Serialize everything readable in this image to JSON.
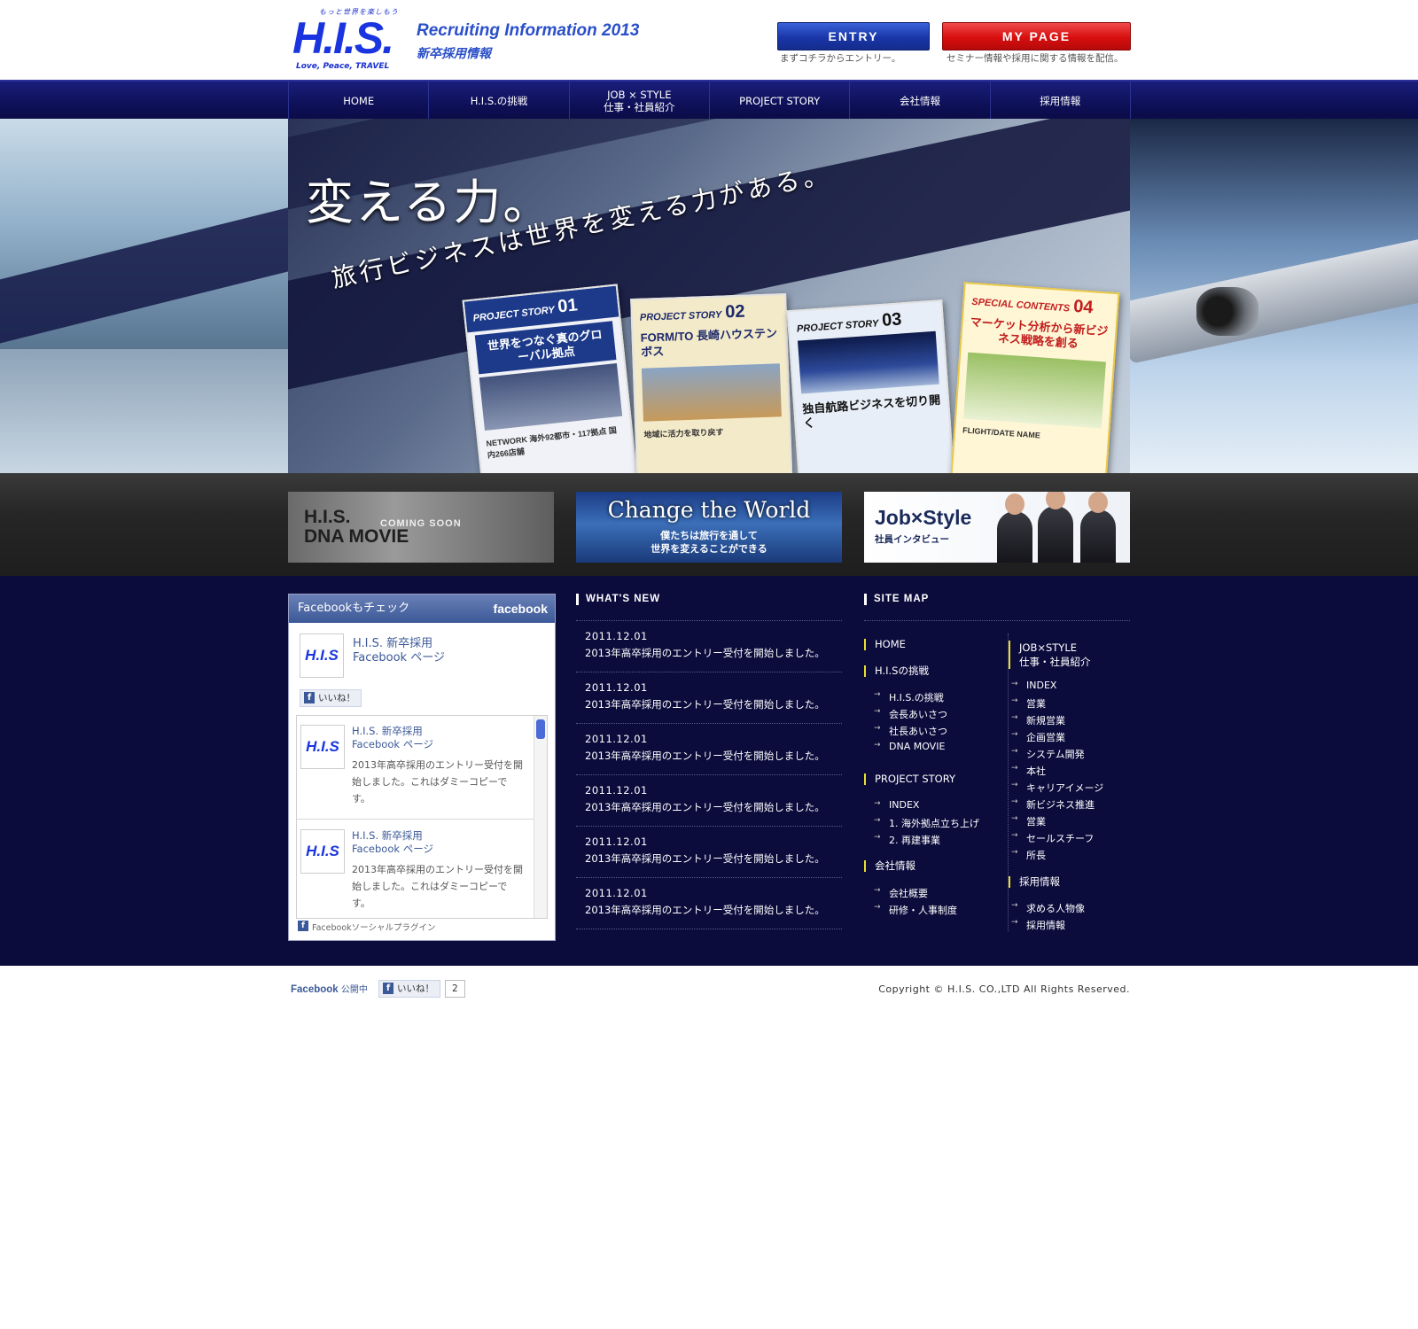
{
  "header": {
    "logo_tagline": "もっと世界を楽しもう",
    "logo_mark": "H.I.S.",
    "logo_slogan": "Love, Peace, TRAVEL",
    "title": "Recruiting Information 2013",
    "subtitle": "新卒採用情報",
    "entry_button": "ENTRY",
    "entry_note": "まずコチラからエントリー。",
    "mypage_button": "MY PAGE",
    "mypage_note": "セミナー情報や採用に関する情報を配信。",
    "colors": {
      "brand": "#1a35e0",
      "entry": "#1a36a8",
      "mypage": "#d80e0e"
    }
  },
  "nav": [
    {
      "label": "HOME"
    },
    {
      "label": "H.I.S.の挑戦"
    },
    {
      "label": "JOB × STYLE\n仕事・社員紹介"
    },
    {
      "label": "PROJECT STORY"
    },
    {
      "label": "会社情報"
    },
    {
      "label": "採用情報"
    }
  ],
  "hero": {
    "headline": "変える力。",
    "subline": "旅行ビジネスは世界を変える力がある。",
    "cards": [
      {
        "kicker": "PROJECT STORY",
        "num": "01",
        "headline": "世界をつなぐ真のグローバル拠点",
        "foot": "NETWORK 海外92都市・117拠点 国内266店舗"
      },
      {
        "kicker": "PROJECT STORY",
        "num": "02",
        "headline": "FORM/TO 長崎ハウステンボス",
        "foot": "地域に活力を取り戻す"
      },
      {
        "kicker": "PROJECT STORY",
        "num": "03",
        "headline": "独自航路ビジネスを切り開く",
        "foot": ""
      },
      {
        "kicker": "SPECIAL CONTENTS",
        "num": "04",
        "headline": "マーケット分析から新ビジネス戦略を創る",
        "foot": "FLIGHT/DATE  NAME"
      }
    ]
  },
  "banners": {
    "dna": {
      "title": "H.I.S.\nDNA MOVIE",
      "badge": "COMING SOON"
    },
    "world": {
      "title": "Change the World",
      "text": "僕たちは旅行を通して\n世界を変えることができる"
    },
    "job": {
      "title": "Job×Style",
      "text": "社員インタビュー"
    }
  },
  "facebook": {
    "header": "Facebookもチェック",
    "brand": "facebook",
    "avatar_text": "H.I.S",
    "page_name": "H.I.S. 新卒採用\nFacebook ページ",
    "like": "いいね！",
    "posts": [
      {
        "name": "H.I.S. 新卒採用\nFacebook ページ",
        "message": "2013年高卒採用のエントリー受付を開始しました。これはダミーコピーです。"
      },
      {
        "name": "H.I.S. 新卒採用\nFacebook ページ",
        "message": "2013年高卒採用のエントリー受付を開始しました。これはダミーコピーです。"
      }
    ],
    "plugin_note": "Facebookソーシャルプラグイン"
  },
  "whats_new": {
    "title": "WHAT'S NEW",
    "items": [
      {
        "date": "2011.12.01",
        "text": "2013年高卒採用のエントリー受付を開始しました。"
      },
      {
        "date": "2011.12.01",
        "text": "2013年高卒採用のエントリー受付を開始しました。"
      },
      {
        "date": "2011.12.01",
        "text": "2013年高卒採用のエントリー受付を開始しました。"
      },
      {
        "date": "2011.12.01",
        "text": "2013年高卒採用のエントリー受付を開始しました。"
      },
      {
        "date": "2011.12.01",
        "text": "2013年高卒採用のエントリー受付を開始しました。"
      },
      {
        "date": "2011.12.01",
        "text": "2013年高卒採用のエントリー受付を開始しました。"
      }
    ]
  },
  "sitemap": {
    "title": "SITE MAP",
    "col1": {
      "home": "HOME",
      "challenge": {
        "head": "H.I.Sの挑戦",
        "links": [
          "H.I.S.の挑戦",
          "会長あいさつ",
          "社長あいさつ",
          "DNA MOVIE"
        ]
      },
      "project": {
        "head": "PROJECT STORY",
        "links": [
          "INDEX",
          "1. 海外拠点立ち上げ",
          "2. 再建事業"
        ]
      },
      "company": {
        "head": "会社情報",
        "links": [
          "会社概要",
          "研修・人事制度"
        ]
      }
    },
    "col2": {
      "job": {
        "head": "JOB×STYLE\n仕事・社員紹介",
        "links": [
          "INDEX",
          "営業",
          "新規営業",
          "企画営業",
          "システム開発",
          "本社",
          "キャリアイメージ",
          "新ビジネス推進",
          "営業",
          "セールスチーフ",
          "所長"
        ]
      },
      "recruit": {
        "head": "採用情報",
        "links": [
          "求める人物像",
          "採用情報"
        ]
      }
    }
  },
  "footer": {
    "fb_label": "Facebook",
    "fb_status": "公開中",
    "like": "いいね！",
    "like_count": "2",
    "copyright": "Copyright © H.I.S. CO.,LTD All Rights Reserved."
  }
}
